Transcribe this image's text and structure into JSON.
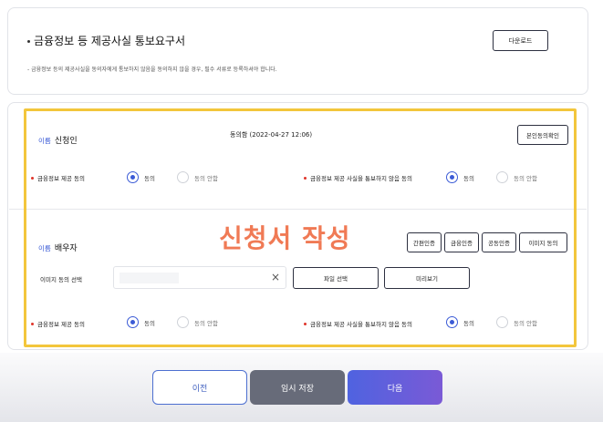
{
  "top_card": {
    "title": "금융정보 등 제공사실 통보요구서",
    "download_label": "다운로드",
    "note": "- 금융정보 등의 제공사실을 동의자에게 통보하지 않음을 동의하지 않을 경우, 필수 서류로 등록하셔야 합니다."
  },
  "applicant": {
    "name_label": "이름",
    "name_value": "신청인",
    "consent_date": "동의함 (2022-04-27 12:06)",
    "verify_label": "본인동의확인",
    "q1": "금융정보 제공 동의",
    "q2": "금융정보 제공 사실을 통보하지 않음 동의",
    "agree": "동의",
    "disagree": "동의 안함"
  },
  "spouse": {
    "name_label": "이름",
    "name_value": "배우자",
    "auth_buttons": [
      "간편인증",
      "금융인증",
      "공동인증",
      "이미지 동의"
    ],
    "image_consent_label": "이미지 동의 선택",
    "clear_icon": "×",
    "file_select_label": "파일 선택",
    "preview_label": "미리보기",
    "q1": "금융정보 제공 동의",
    "q2": "금융정보 제공 사실을 통보하지 않음 동의",
    "agree": "동의",
    "disagree": "동의 안함"
  },
  "overlay_title": "신청서 작성",
  "footer": {
    "prev_label": "이전",
    "save_label": "임시 저장",
    "next_label": "다음"
  },
  "colors": {
    "accent": "#3b5bd6",
    "highlight": "#f3c63c",
    "overlay_text": "#f07a55",
    "required_dot": "#e0352b"
  }
}
